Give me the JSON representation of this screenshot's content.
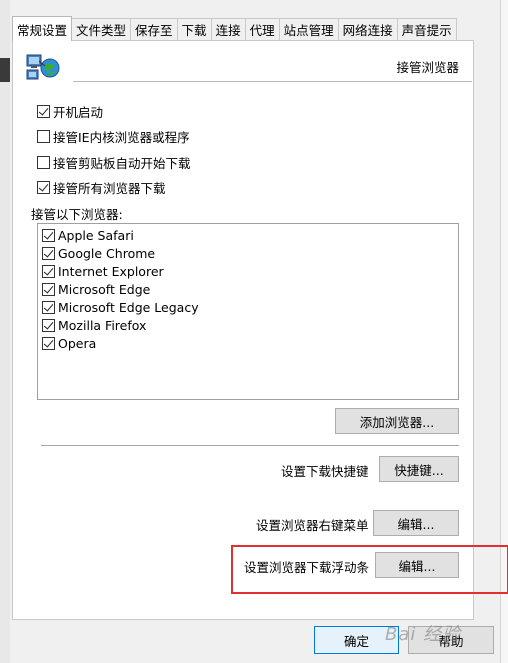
{
  "tabs": [
    {
      "label": "常规设置",
      "active": true
    },
    {
      "label": "文件类型",
      "active": false
    },
    {
      "label": "保存至",
      "active": false
    },
    {
      "label": "下载",
      "active": false
    },
    {
      "label": "连接",
      "active": false
    },
    {
      "label": "代理",
      "active": false
    },
    {
      "label": "站点管理",
      "active": false
    },
    {
      "label": "网络连接",
      "active": false
    },
    {
      "label": "声音提示",
      "active": false
    }
  ],
  "header": {
    "title": "接管浏览器",
    "icon": "network-globe-icon"
  },
  "options": [
    {
      "label": "开机启动",
      "checked": true
    },
    {
      "label": "接管IE内核浏览器或程序",
      "checked": false
    },
    {
      "label": "接管剪贴板自动开始下载",
      "checked": false
    },
    {
      "label": "接管所有浏览器下载",
      "checked": true
    }
  ],
  "browsers": {
    "group_label": "接管以下浏览器:",
    "items": [
      {
        "label": "Apple Safari",
        "checked": true
      },
      {
        "label": "Google Chrome",
        "checked": true
      },
      {
        "label": "Internet Explorer",
        "checked": true
      },
      {
        "label": "Microsoft Edge",
        "checked": true
      },
      {
        "label": "Microsoft Edge Legacy",
        "checked": true
      },
      {
        "label": "Mozilla Firefox",
        "checked": true
      },
      {
        "label": "Opera",
        "checked": true
      }
    ],
    "add_button": "添加浏览器..."
  },
  "shortcut": {
    "label": "设置下载快捷键",
    "button": "快捷键..."
  },
  "context_menu": {
    "label": "设置浏览器右键菜单",
    "button": "编辑..."
  },
  "float_bar": {
    "label": "设置浏览器下载浮动条",
    "button": "编辑..."
  },
  "footer": {
    "ok": "确定",
    "help": "帮助"
  },
  "watermark": "Bai 经验",
  "colors": {
    "highlight": "#e03030",
    "accent": "#0078d7"
  }
}
